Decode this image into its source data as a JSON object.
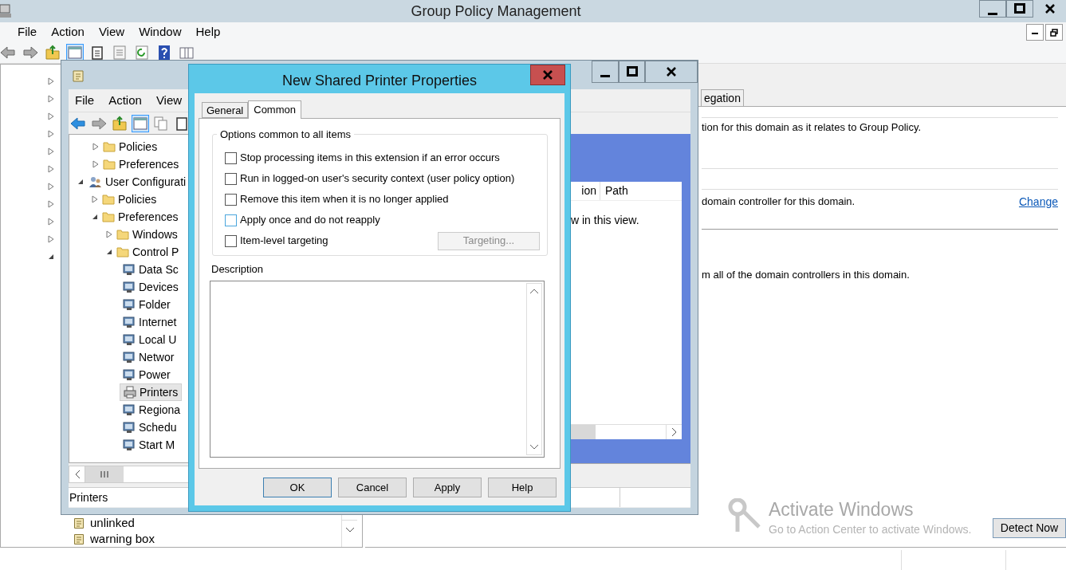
{
  "main_window": {
    "title": "Group Policy Management",
    "menu": [
      "File",
      "Action",
      "View",
      "Window",
      "Help"
    ],
    "left_tree": {
      "rows": [
        {
          "expanded": false
        },
        {
          "expanded": false
        },
        {
          "expanded": false
        },
        {
          "expanded": false
        },
        {
          "expanded": false
        },
        {
          "expanded": false
        },
        {
          "expanded": false
        },
        {
          "expanded": false
        },
        {
          "expanded": false
        },
        {
          "expanded": false
        },
        {
          "expanded": true
        }
      ],
      "items": [
        {
          "label": "unlinked"
        },
        {
          "label": "warning box"
        }
      ]
    },
    "details": {
      "tab": "egation",
      "lines": [
        {
          "text": "tion for this domain as it relates to Group Policy."
        },
        {
          "text": "domain controller for this domain.",
          "link": "Change"
        },
        {
          "text": "m all of the domain controllers in this domain."
        }
      ],
      "button": "Detect Now"
    },
    "activation_notice": {
      "title": "Activate Windows",
      "message": "Go to Action Center to activate Windows."
    }
  },
  "editor_window": {
    "menu": [
      "File",
      "Action",
      "View"
    ],
    "tree": {
      "continued_items": [
        {
          "label": "Policies",
          "expanded": false
        },
        {
          "label": "Preferences",
          "expanded": false
        }
      ],
      "items": [
        {
          "label": "User Configurati",
          "expanded": true,
          "children": [
            {
              "label": "Policies",
              "expanded": false
            },
            {
              "label": "Preferences",
              "expanded": true,
              "children": [
                {
                  "label": "Windows",
                  "expanded": false
                },
                {
                  "label": "Control P",
                  "expanded": true,
                  "children": [
                    {
                      "label": "Data Sc",
                      "selected": false
                    },
                    {
                      "label": "Devices",
                      "selected": false
                    },
                    {
                      "label": "Folder",
                      "selected": false
                    },
                    {
                      "label": "Internet",
                      "selected": false
                    },
                    {
                      "label": "Local U",
                      "selected": false
                    },
                    {
                      "label": "Networ",
                      "selected": false
                    },
                    {
                      "label": "Power",
                      "selected": false
                    },
                    {
                      "label": "Printers",
                      "selected": true
                    },
                    {
                      "label": "Regiona",
                      "selected": false
                    },
                    {
                      "label": "Schedu",
                      "selected": false
                    },
                    {
                      "label": "Start M",
                      "selected": false
                    }
                  ]
                }
              ]
            }
          ]
        }
      ]
    },
    "list": {
      "columns": [
        "ion",
        "Path"
      ],
      "empty_text": "w in this view."
    },
    "status_bar": "Printers"
  },
  "dialog": {
    "title": "New Shared Printer Properties",
    "tabs": [
      {
        "label": "General",
        "selected": false
      },
      {
        "label": "Common",
        "selected": true
      }
    ],
    "group_title": "Options common to all items",
    "options": [
      {
        "label": "Stop processing items in this extension if an error occurs",
        "checked": false,
        "hovered": false
      },
      {
        "label": "Run in logged-on user's security context (user policy option)",
        "checked": false,
        "hovered": false
      },
      {
        "label": "Remove this item when it is no longer applied",
        "checked": false,
        "hovered": false
      },
      {
        "label": "Apply once and do not reapply",
        "checked": false,
        "hovered": true
      },
      {
        "label": "Item-level targeting",
        "checked": false,
        "hovered": false
      }
    ],
    "targeting_button": {
      "label": "Targeting...",
      "disabled": true
    },
    "description_label": "Description",
    "buttons": [
      {
        "label": "OK",
        "default": true
      },
      {
        "label": "Cancel",
        "default": false
      },
      {
        "label": "Apply",
        "default": false
      },
      {
        "label": "Help",
        "default": false
      }
    ]
  }
}
